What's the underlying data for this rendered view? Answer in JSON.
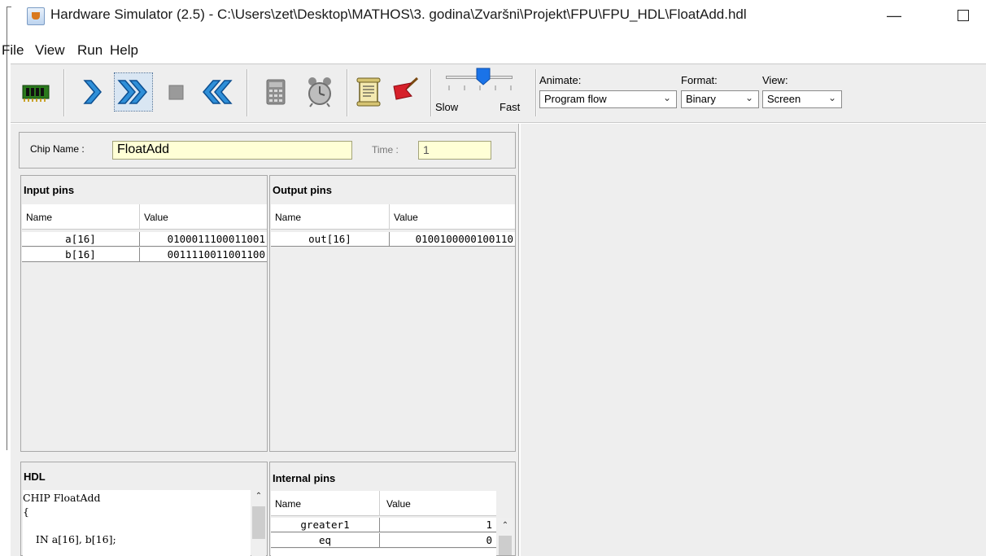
{
  "window": {
    "title": "Hardware Simulator (2.5) - C:\\Users\\zet\\Desktop\\MATHOS\\3. godina\\Zvaršni\\Projekt\\FPU\\FPU_HDL\\FloatAdd.hdl",
    "minimize": "—"
  },
  "menu": [
    "File",
    "View",
    "Run",
    "Help"
  ],
  "toolbar": {
    "slider": {
      "slow_label": "Slow",
      "fast_label": "Fast",
      "level": 0.55
    },
    "animate": {
      "label": "Animate:",
      "value": "Program flow"
    },
    "format": {
      "label": "Format:",
      "value": "Binary"
    },
    "view": {
      "label": "View:",
      "value": "Screen"
    }
  },
  "chip": {
    "name_label": "Chip Name :",
    "name": "FloatAdd",
    "time_label": "Time :",
    "time": "1"
  },
  "input_pins": {
    "title": "Input pins",
    "headers": [
      "Name",
      "Value"
    ],
    "rows": [
      {
        "name": "a[16]",
        "value": "0100011100011001"
      },
      {
        "name": "b[16]",
        "value": "0011110011001100"
      }
    ]
  },
  "output_pins": {
    "title": "Output pins",
    "headers": [
      "Name",
      "Value"
    ],
    "rows": [
      {
        "name": "out[16]",
        "value": "0100100000100110"
      }
    ]
  },
  "hdl": {
    "title": "HDL",
    "code": "CHIP FloatAdd\n{\n\n    IN a[16], b[16];"
  },
  "internal_pins": {
    "title": "Internal pins",
    "headers": [
      "Name",
      "Value"
    ],
    "rows": [
      {
        "name": "greater1",
        "value": "1"
      },
      {
        "name": "eq",
        "value": "0"
      }
    ]
  }
}
